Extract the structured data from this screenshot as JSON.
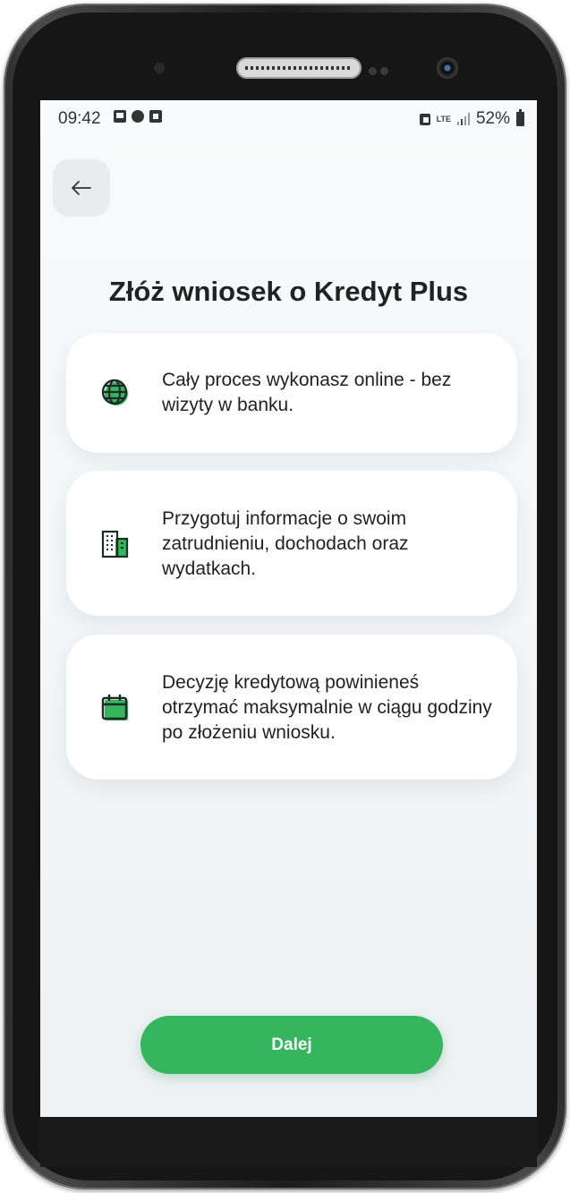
{
  "status_bar": {
    "time": "09:42",
    "network": "LTE",
    "battery": "52%"
  },
  "header": {
    "back_icon": "arrow-left-icon"
  },
  "title": "Złóż wniosek o Kredyt Plus",
  "cards": [
    {
      "icon": "globe-icon",
      "text": "Cały proces wykonasz online - bez wizyty w banku."
    },
    {
      "icon": "building-icon",
      "text": "Przygotuj informacje o swoim zatrudnieniu, dochodach oraz wydatkach."
    },
    {
      "icon": "calendar-icon",
      "text": "Decyzję kredytową powinieneś otrzymać maksymalnie w ciągu godziny po złożeniu wniosku."
    }
  ],
  "cta": {
    "label": "Dalej"
  },
  "colors": {
    "accent": "#35b55d",
    "icon_dark": "#1d2b24",
    "background": "#eef1f3"
  }
}
